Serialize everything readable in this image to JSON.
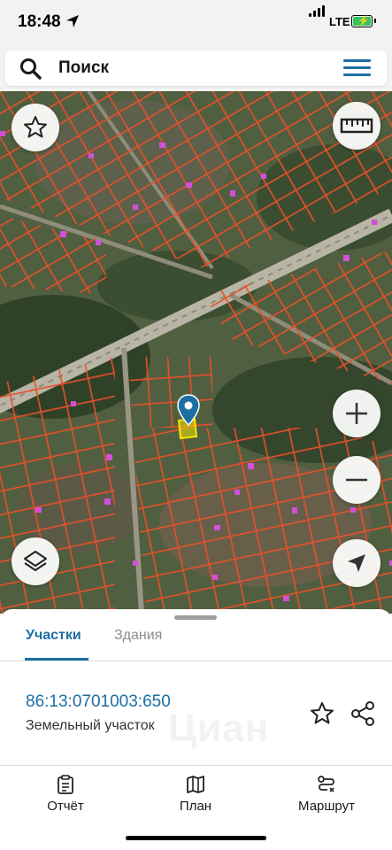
{
  "status": {
    "time": "18:48",
    "network": "LTE"
  },
  "search": {
    "placeholder": "Поиск"
  },
  "map": {
    "parcel_highlight_color": "#f2e600",
    "parcel_outline_color": "#e8502a",
    "marker_color": "#1d6fa3"
  },
  "sheet": {
    "tabs": [
      {
        "label": "Участки",
        "active": true
      },
      {
        "label": "Здания",
        "active": false
      }
    ],
    "parcel": {
      "cadastral_number": "86:13:0701003:650",
      "type": "Земельный участок"
    },
    "watermark": "Циан"
  },
  "bottom_nav": [
    {
      "label": "Отчёт",
      "icon": "report-icon"
    },
    {
      "label": "План",
      "icon": "map-plan-icon"
    },
    {
      "label": "Маршрут",
      "icon": "route-icon"
    }
  ],
  "colors": {
    "accent": "#1d6fa3",
    "parcel_lines": "#e8502a"
  }
}
